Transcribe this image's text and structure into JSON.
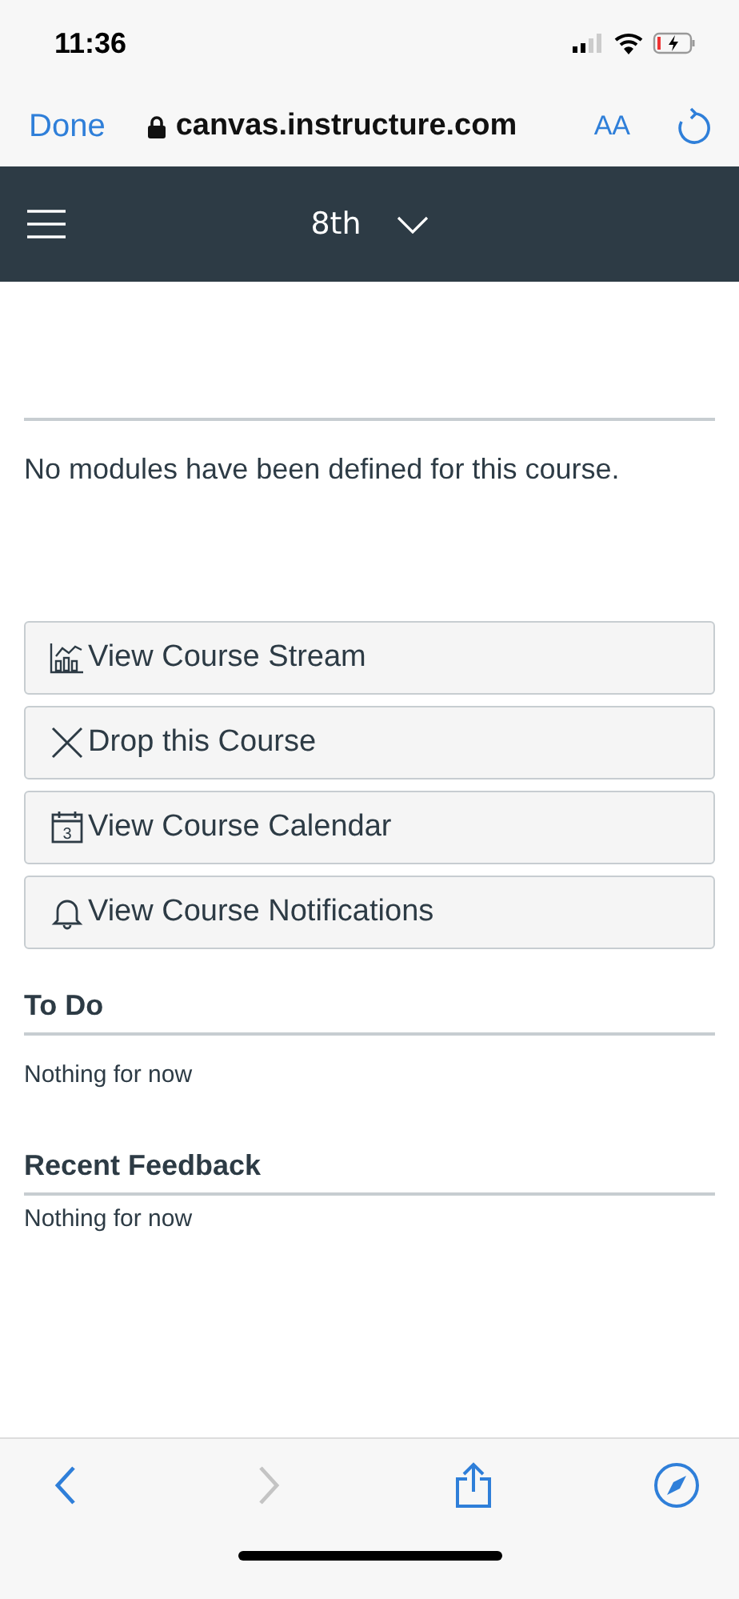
{
  "status_bar": {
    "time": "11:36"
  },
  "browser_bar": {
    "done": "Done",
    "url": "canvas.instructure.com",
    "text_size": "AA"
  },
  "course_nav": {
    "title": "8th"
  },
  "modules": {
    "message": "No modules have been defined for this course."
  },
  "actions": [
    {
      "kind": "stream",
      "label": "View Course Stream"
    },
    {
      "kind": "drop",
      "label": "Drop this Course"
    },
    {
      "kind": "calendar",
      "label": "View Course Calendar",
      "day": "3"
    },
    {
      "kind": "bell",
      "label": "View Course Notifications"
    }
  ],
  "sections": [
    {
      "heading": "To Do",
      "text": "Nothing for now"
    },
    {
      "heading": "Recent Feedback",
      "text": "Nothing for now"
    }
  ],
  "toolbar": [
    {
      "kind": "back",
      "disabled": false
    },
    {
      "kind": "forward",
      "disabled": true
    },
    {
      "kind": "share",
      "disabled": false
    },
    {
      "kind": "compass",
      "disabled": false
    }
  ]
}
